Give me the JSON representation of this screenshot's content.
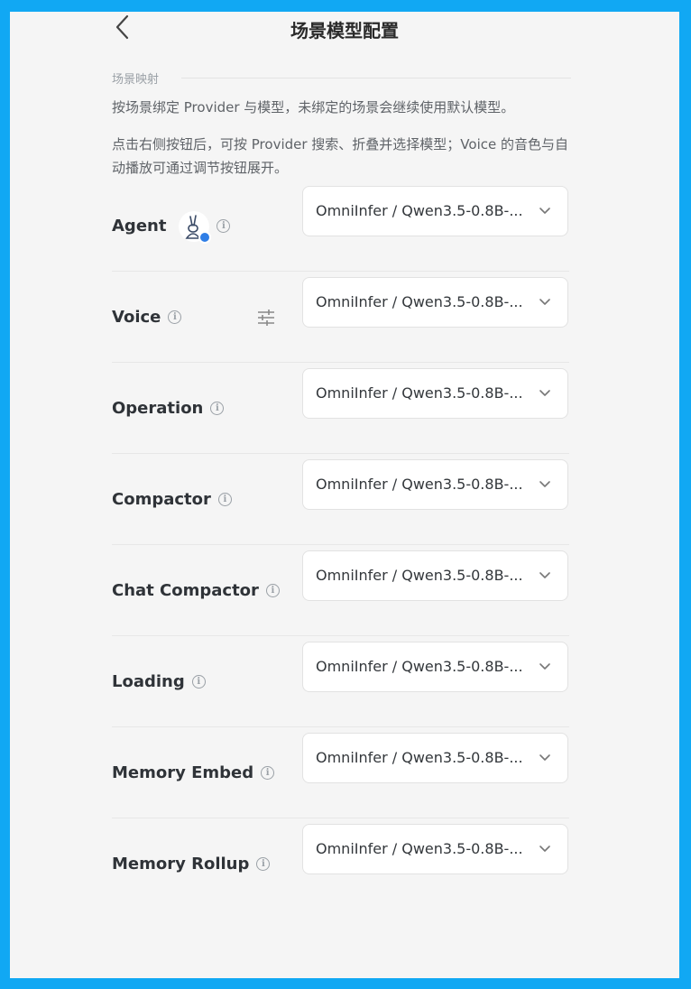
{
  "header": {
    "title": "场景模型配置"
  },
  "section": {
    "label": "场景映射",
    "desc1": "按场景绑定 Provider 与模型，未绑定的场景会继续使用默认模型。",
    "desc2": "点击右侧按钮后，可按 Provider 搜索、折叠并选择模型；Voice 的音色与自动播放可通过调节按钮展开。"
  },
  "info_glyph": "i",
  "rows": [
    {
      "label": "Agent",
      "value": "OmniInfer / Qwen3.5-0.8B-..."
    },
    {
      "label": "Voice",
      "value": "OmniInfer / Qwen3.5-0.8B-..."
    },
    {
      "label": "Operation",
      "value": "OmniInfer / Qwen3.5-0.8B-..."
    },
    {
      "label": "Compactor",
      "value": "OmniInfer / Qwen3.5-0.8B-..."
    },
    {
      "label": "Chat Compactor",
      "value": "OmniInfer / Qwen3.5-0.8B-..."
    },
    {
      "label": "Loading",
      "value": "OmniInfer / Qwen3.5-0.8B-..."
    },
    {
      "label": "Memory Embed",
      "value": "OmniInfer / Qwen3.5-0.8B-..."
    },
    {
      "label": "Memory Rollup",
      "value": "OmniInfer / Qwen3.5-0.8B-..."
    }
  ],
  "icons": {
    "back": "chevron-left-icon",
    "info": "info-icon",
    "dropdown": "chevron-down-icon",
    "tune": "sliders-icon",
    "agent_avatar": "rabbit-avatar-icon",
    "agent_badge": "edit-badge-icon"
  },
  "colors": {
    "frame_border": "#11a8f3",
    "background": "#f5f5f5",
    "badge": "#2f7ee6"
  }
}
